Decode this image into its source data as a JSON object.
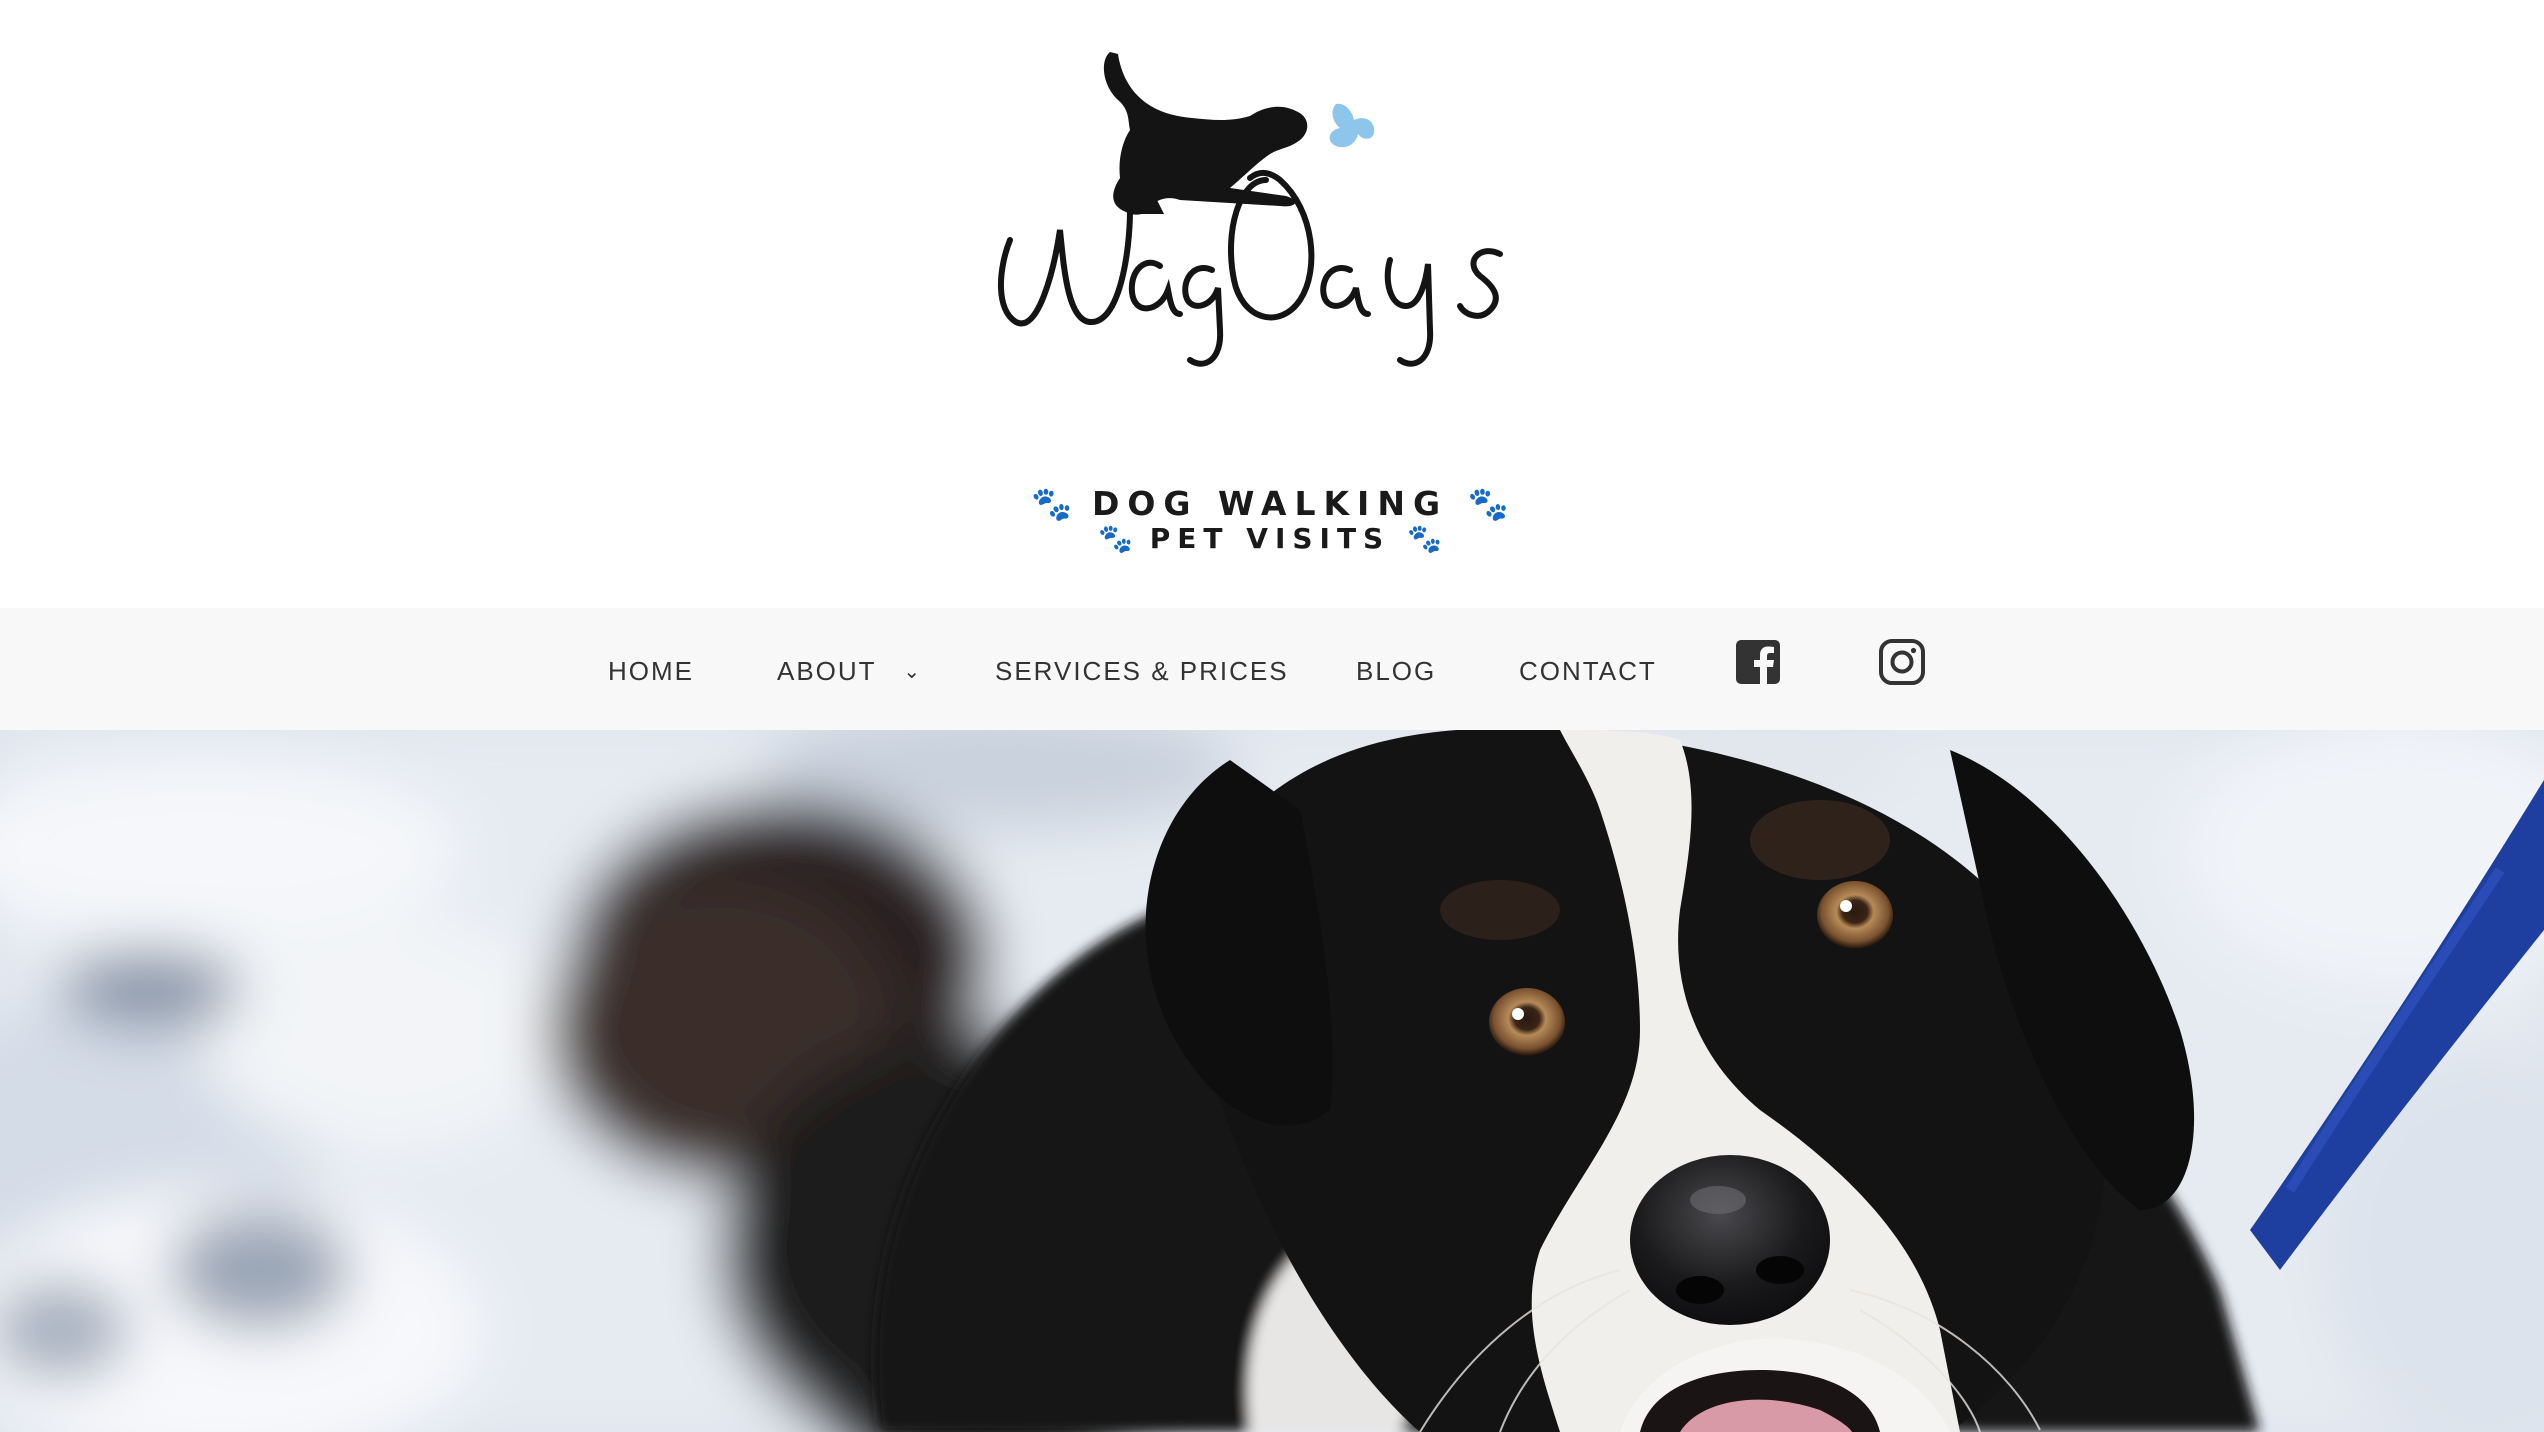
{
  "brand": {
    "script_name": "WagDays",
    "tagline_line1": "DOG WALKING",
    "tagline_line2": "PET VISITS",
    "accent_color": "#8ec5ea",
    "logo_color": "#141414"
  },
  "nav": {
    "items": [
      {
        "label": "HOME"
      },
      {
        "label": "ABOUT",
        "has_dropdown": true
      },
      {
        "label": "SERVICES & PRICES"
      },
      {
        "label": "BLOG"
      },
      {
        "label": "CONTACT"
      }
    ],
    "chevron_glyph": "⌄",
    "social": [
      {
        "icon": "facebook-icon"
      },
      {
        "icon": "instagram-icon"
      }
    ]
  },
  "hero": {
    "image_subject": "black-and-white-dog-in-snow-photo"
  }
}
